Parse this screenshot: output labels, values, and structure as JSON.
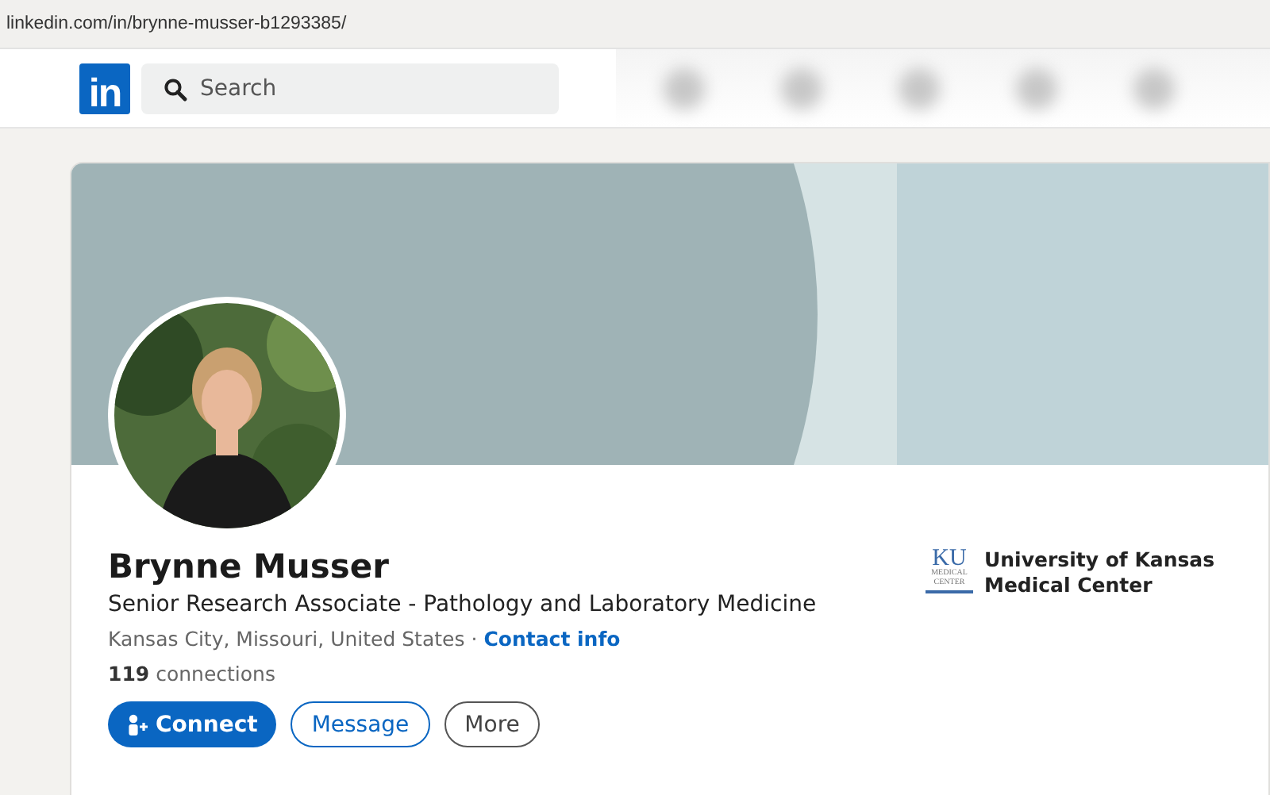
{
  "address_bar": {
    "url": "linkedin.com/in/brynne-musser-b1293385/"
  },
  "nav": {
    "logo": "in",
    "search": {
      "placeholder": "Search"
    }
  },
  "profile": {
    "name": "Brynne Musser",
    "headline": "Senior Research Associate - Pathology and Laboratory Medicine",
    "location": "Kansas City, Missouri, United States",
    "separator": "·",
    "contact_link": "Contact info",
    "connections_count": "119",
    "connections_label": "connections",
    "buttons": [
      {
        "label": "Connect",
        "kind": "primary"
      },
      {
        "label": "Message",
        "kind": "secondary"
      },
      {
        "label": "More",
        "kind": "tertiary"
      }
    ],
    "education": {
      "logo_lines": [
        "KU",
        "MEDICAL",
        "CENTER"
      ],
      "name": "University of Kansas Medical Center"
    }
  }
}
